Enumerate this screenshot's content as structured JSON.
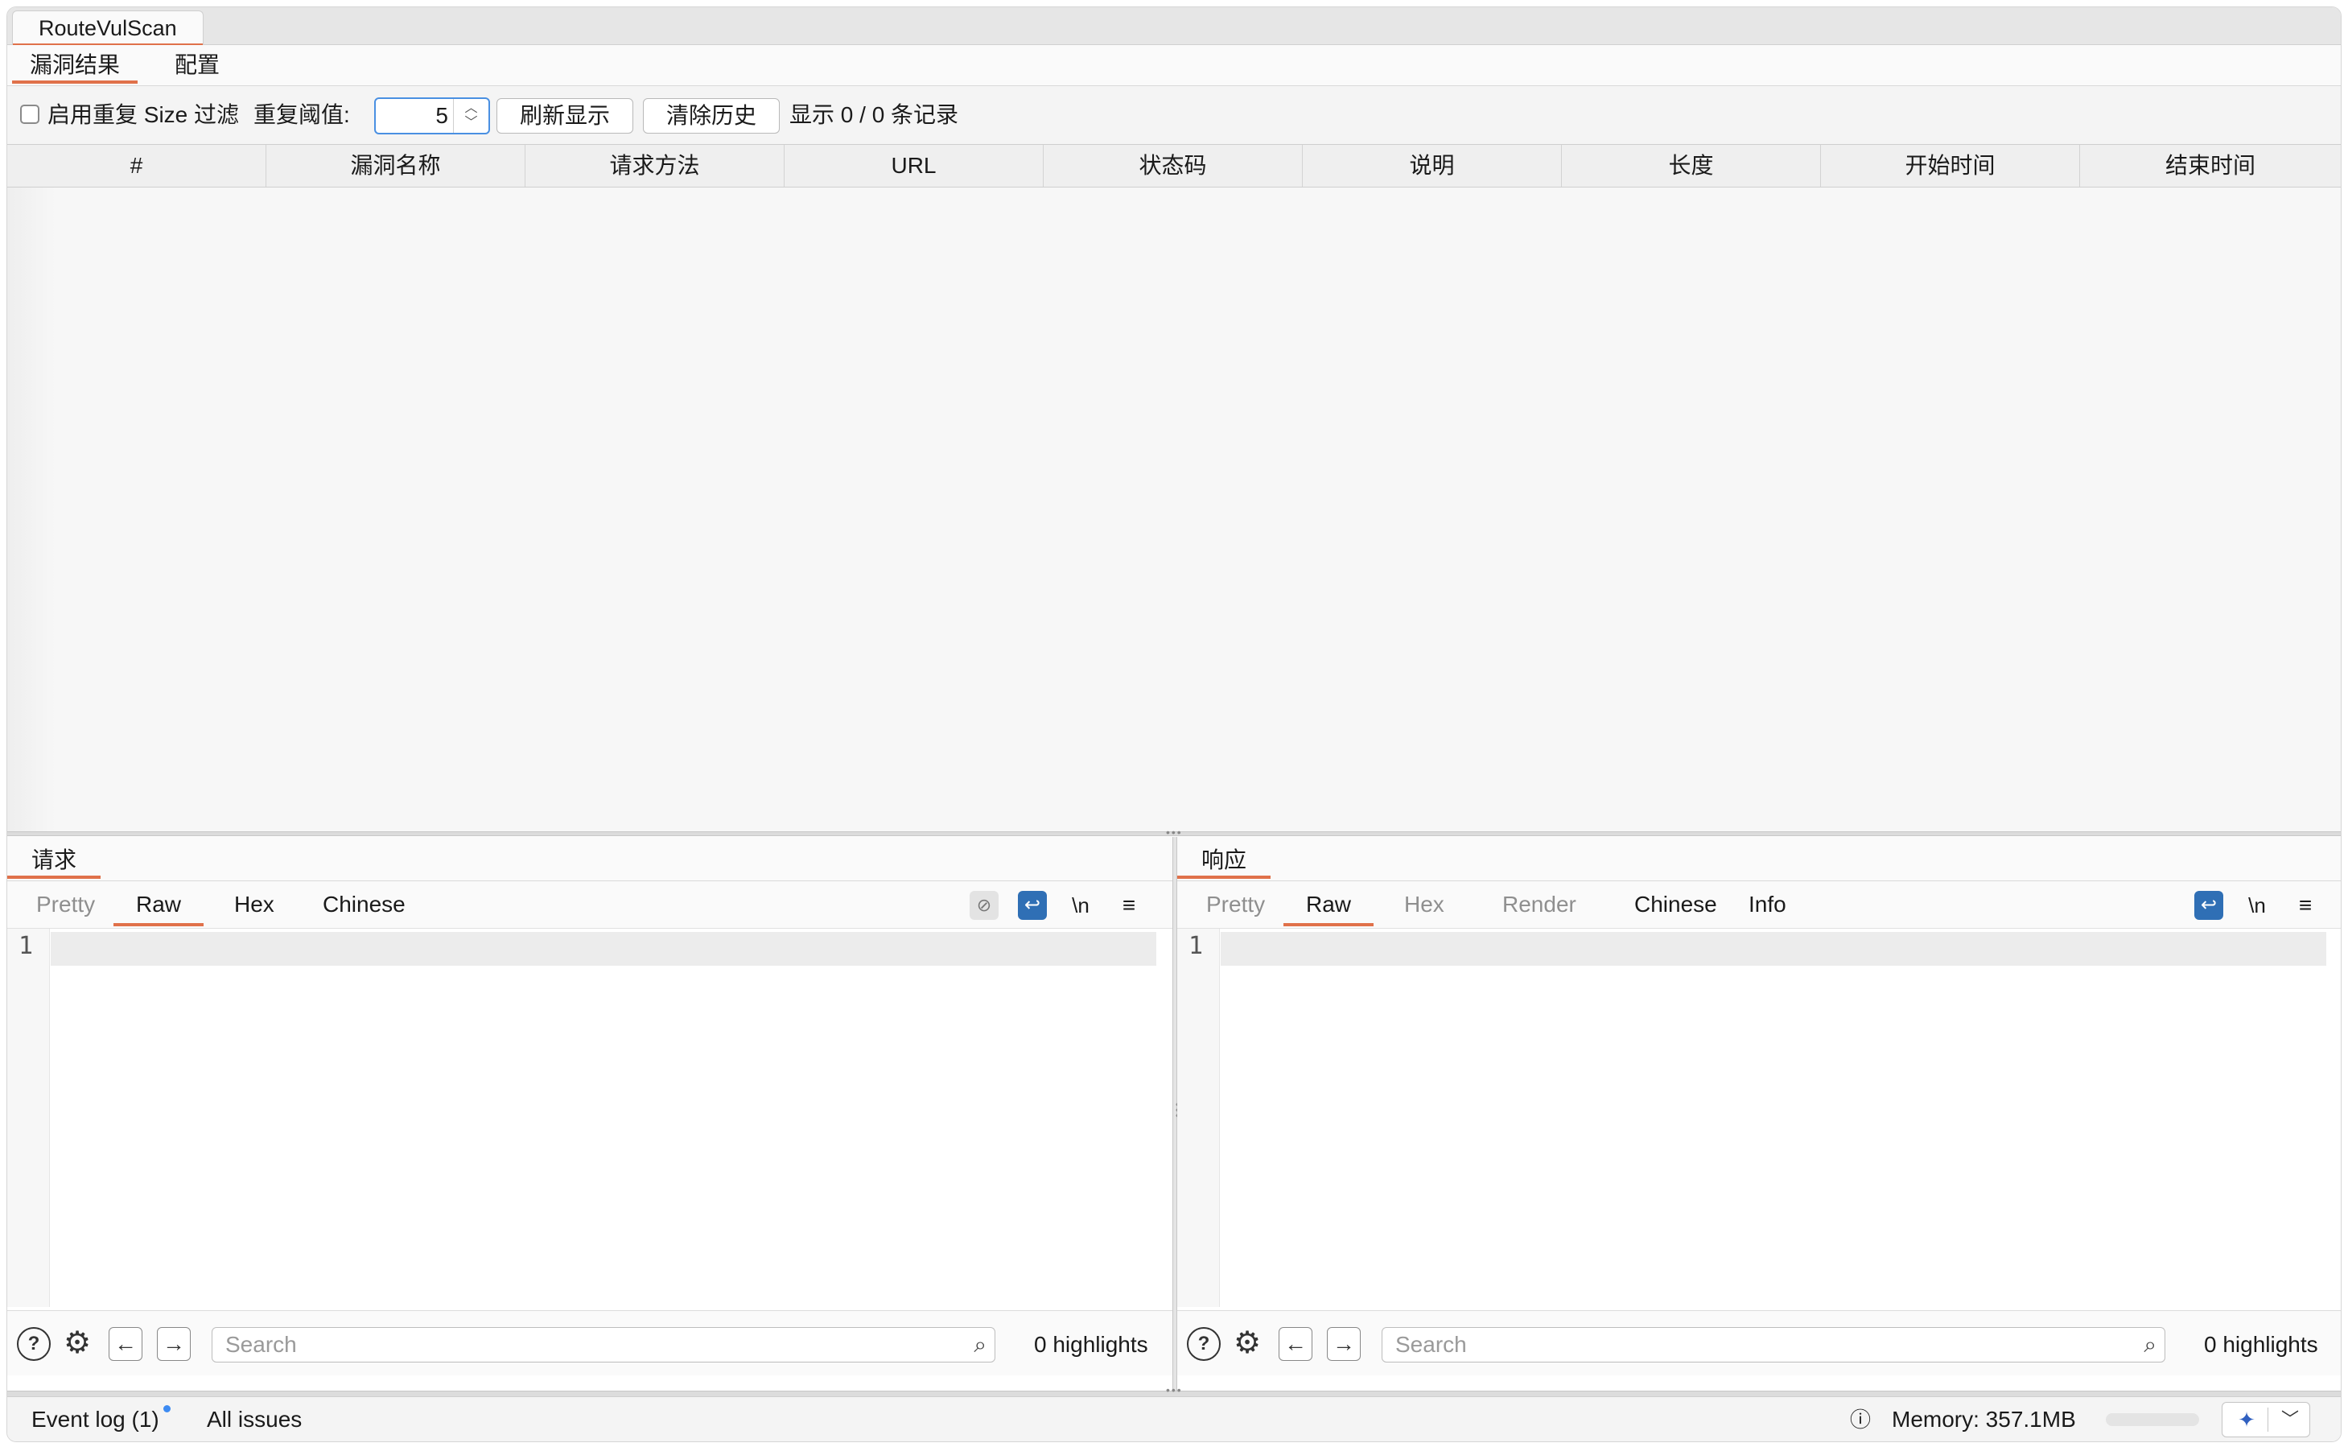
{
  "plugin_tab": "RouteVulScan",
  "sub_tabs": [
    "漏洞结果",
    "配置"
  ],
  "toolbar": {
    "filter_checkbox_label": "启用重复 Size 过滤",
    "threshold_label": "重复阈值:",
    "threshold_value": "5",
    "refresh_button": "刷新显示",
    "clear_button": "清除历史",
    "record_count": "显示 0 / 0 条记录"
  },
  "table": {
    "columns": [
      "#",
      "漏洞名称",
      "请求方法",
      "URL",
      "状态码",
      "说明",
      "长度",
      "开始时间",
      "结束时间"
    ],
    "rows": []
  },
  "request_pane": {
    "title": "请求",
    "view_tabs": [
      "Pretty",
      "Raw",
      "Hex",
      "Chinese"
    ],
    "active_tab": "Raw",
    "newline_toggle": "\\n",
    "line_number": "1",
    "search_placeholder": "Search",
    "highlights": "0 highlights"
  },
  "response_pane": {
    "title": "响应",
    "view_tabs": [
      "Pretty",
      "Raw",
      "Hex",
      "Render",
      "Chinese",
      "Info"
    ],
    "active_tab": "Raw",
    "newline_toggle": "\\n",
    "line_number": "1",
    "search_placeholder": "Search",
    "highlights": "0 highlights"
  },
  "status_bar": {
    "event_log": "Event log (1)",
    "all_issues": "All issues",
    "memory": "Memory: 357.1MB"
  },
  "colors": {
    "accent_tab_underline": "#e0714a",
    "active_icon_blue": "#2f6fb5",
    "notification_dot": "#3d8bf2",
    "focus_border": "#4a90e2"
  }
}
